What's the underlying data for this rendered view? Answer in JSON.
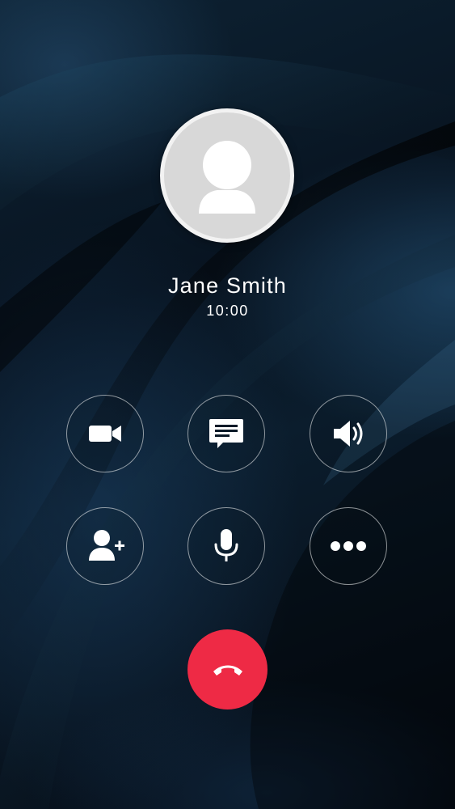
{
  "call": {
    "caller_name": "Jane Smith",
    "duration": "10:00"
  },
  "controls": {
    "row1": [
      {
        "name": "video-button",
        "icon": "video-camera-icon"
      },
      {
        "name": "message-button",
        "icon": "message-icon"
      },
      {
        "name": "speaker-button",
        "icon": "speaker-icon"
      }
    ],
    "row2": [
      {
        "name": "add-participant-button",
        "icon": "add-user-icon"
      },
      {
        "name": "mute-button",
        "icon": "microphone-icon"
      },
      {
        "name": "more-button",
        "icon": "more-icon"
      }
    ]
  },
  "end_call": {
    "icon": "hang-up-icon"
  },
  "colors": {
    "end_call_red": "#ee2a45",
    "avatar_gray": "#d8d8d8",
    "text": "#ffffff"
  }
}
